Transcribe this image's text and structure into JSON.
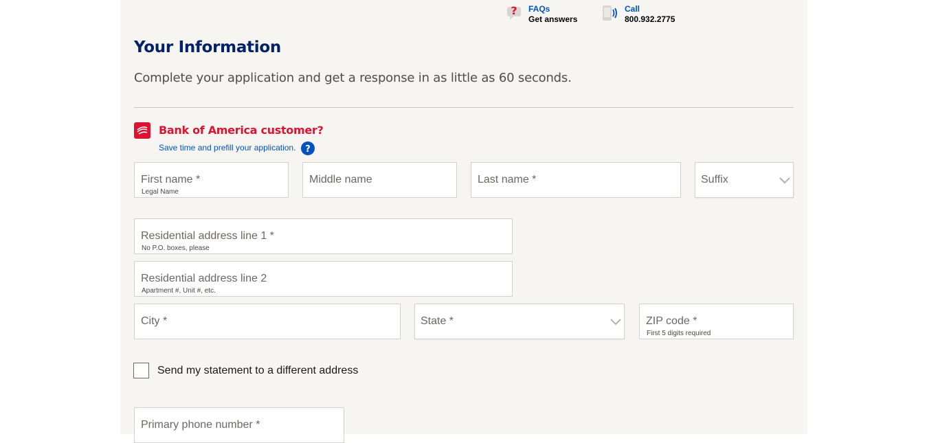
{
  "help": {
    "faq": {
      "link": "FAQs",
      "sub": "Get answers"
    },
    "call": {
      "link": "Call",
      "sub": "800.932.2775"
    }
  },
  "heading": "Your Information",
  "intro": "Complete your application and get a response in as little as 60 seconds.",
  "customer": {
    "title": "Bank of America customer?",
    "prefill_link": "Save time and prefill your application."
  },
  "form": {
    "first_name": {
      "placeholder": "First name *",
      "hint": "Legal Name"
    },
    "middle_name": {
      "placeholder": "Middle name"
    },
    "last_name": {
      "placeholder": "Last name *"
    },
    "suffix": {
      "placeholder": "Suffix"
    },
    "address1": {
      "placeholder": "Residential address line 1 *",
      "hint": "No P.O. boxes, please"
    },
    "address2": {
      "placeholder": "Residential address line 2",
      "hint": "Apartment #, Unit #, etc."
    },
    "city": {
      "placeholder": "City *"
    },
    "state": {
      "placeholder": "State *"
    },
    "zip": {
      "placeholder": "ZIP code *",
      "hint": "First 5 digits required"
    },
    "different_address_label": "Send my statement to a different address",
    "phone": {
      "placeholder": "Primary phone number *"
    }
  },
  "colors": {
    "heading": "#012169",
    "brand_red": "#dc1431",
    "link_blue": "#0052c2",
    "panel_bg": "#f6f5f2"
  },
  "icons": {
    "faq": "question-bubble-icon",
    "call": "phone-icon",
    "brand": "boa-flag-icon",
    "help": "question-circle-icon",
    "dropdown": "chevron-down-icon"
  }
}
